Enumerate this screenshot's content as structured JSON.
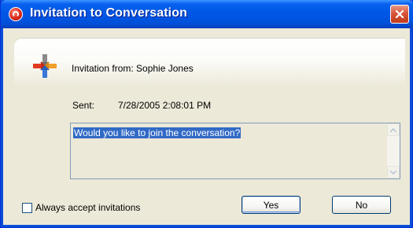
{
  "window": {
    "title": "Invitation to Conversation",
    "close_icon": "close-icon"
  },
  "invitation": {
    "icon": "conversation-icon",
    "from_text": "Invitation from: Sophie Jones"
  },
  "sent": {
    "label": "Sent:",
    "value": "7/28/2005 2:08:01 PM"
  },
  "message": {
    "text": "Would you like to join the conversation?",
    "selected": true
  },
  "options": {
    "always_accept_label": "Always accept invitations",
    "always_accept_checked": false
  },
  "buttons": {
    "yes_label": "Yes",
    "no_label": "No"
  },
  "colors": {
    "titlebar": "#0054e3",
    "client_bg": "#ece9d8",
    "selection": "#316ac5",
    "close_button": "#d8553a"
  }
}
